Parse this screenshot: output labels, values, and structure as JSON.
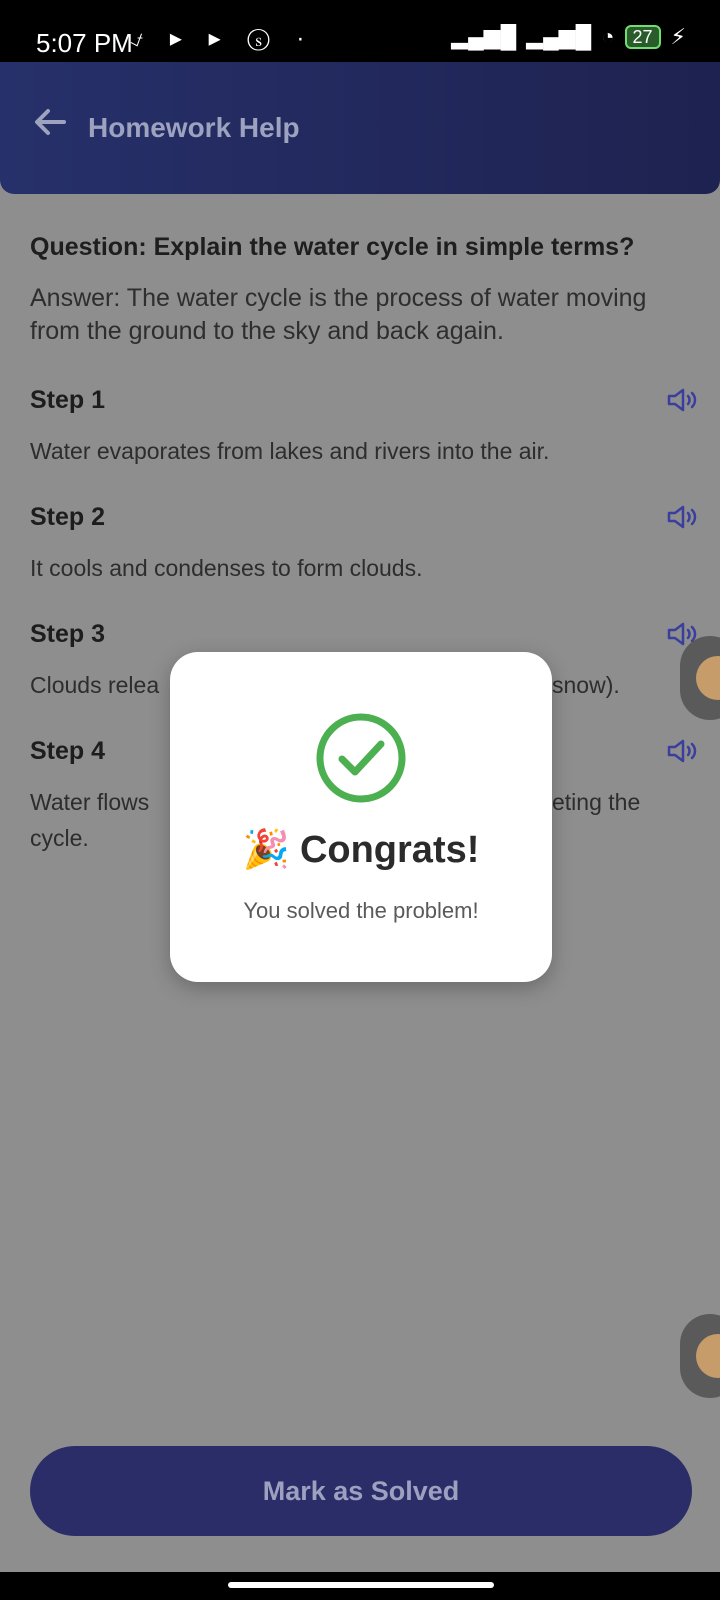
{
  "status_bar": {
    "time": "5:07 PM",
    "left_icons": [
      "bell-off-icon",
      "play-icon",
      "play-icon",
      "s-icon",
      "dot-icon"
    ],
    "battery": "27"
  },
  "header": {
    "title": "Homework Help"
  },
  "question": "Question: Explain the water cycle in simple terms?",
  "answer": "Answer: The water cycle is the process of water moving from the ground to the sky and back again.",
  "steps": [
    {
      "title": "Step 1",
      "text": "Water evaporates from lakes and rivers into the air."
    },
    {
      "title": "Step 2",
      "text": "It cools and condenses to form clouds."
    },
    {
      "title": "Step 3",
      "text": "Clouds relea",
      "text_tail": "snow)."
    },
    {
      "title": "Step 4",
      "text": "Water flows",
      "text_tail": "eting the",
      "text_line2": "cycle."
    }
  ],
  "dialog": {
    "title": "Congrats!",
    "subtitle": "You solved the problem!"
  },
  "button": {
    "label": "Mark as Solved"
  },
  "colors": {
    "accent": "#3a3f9e",
    "success": "#4caf50"
  }
}
